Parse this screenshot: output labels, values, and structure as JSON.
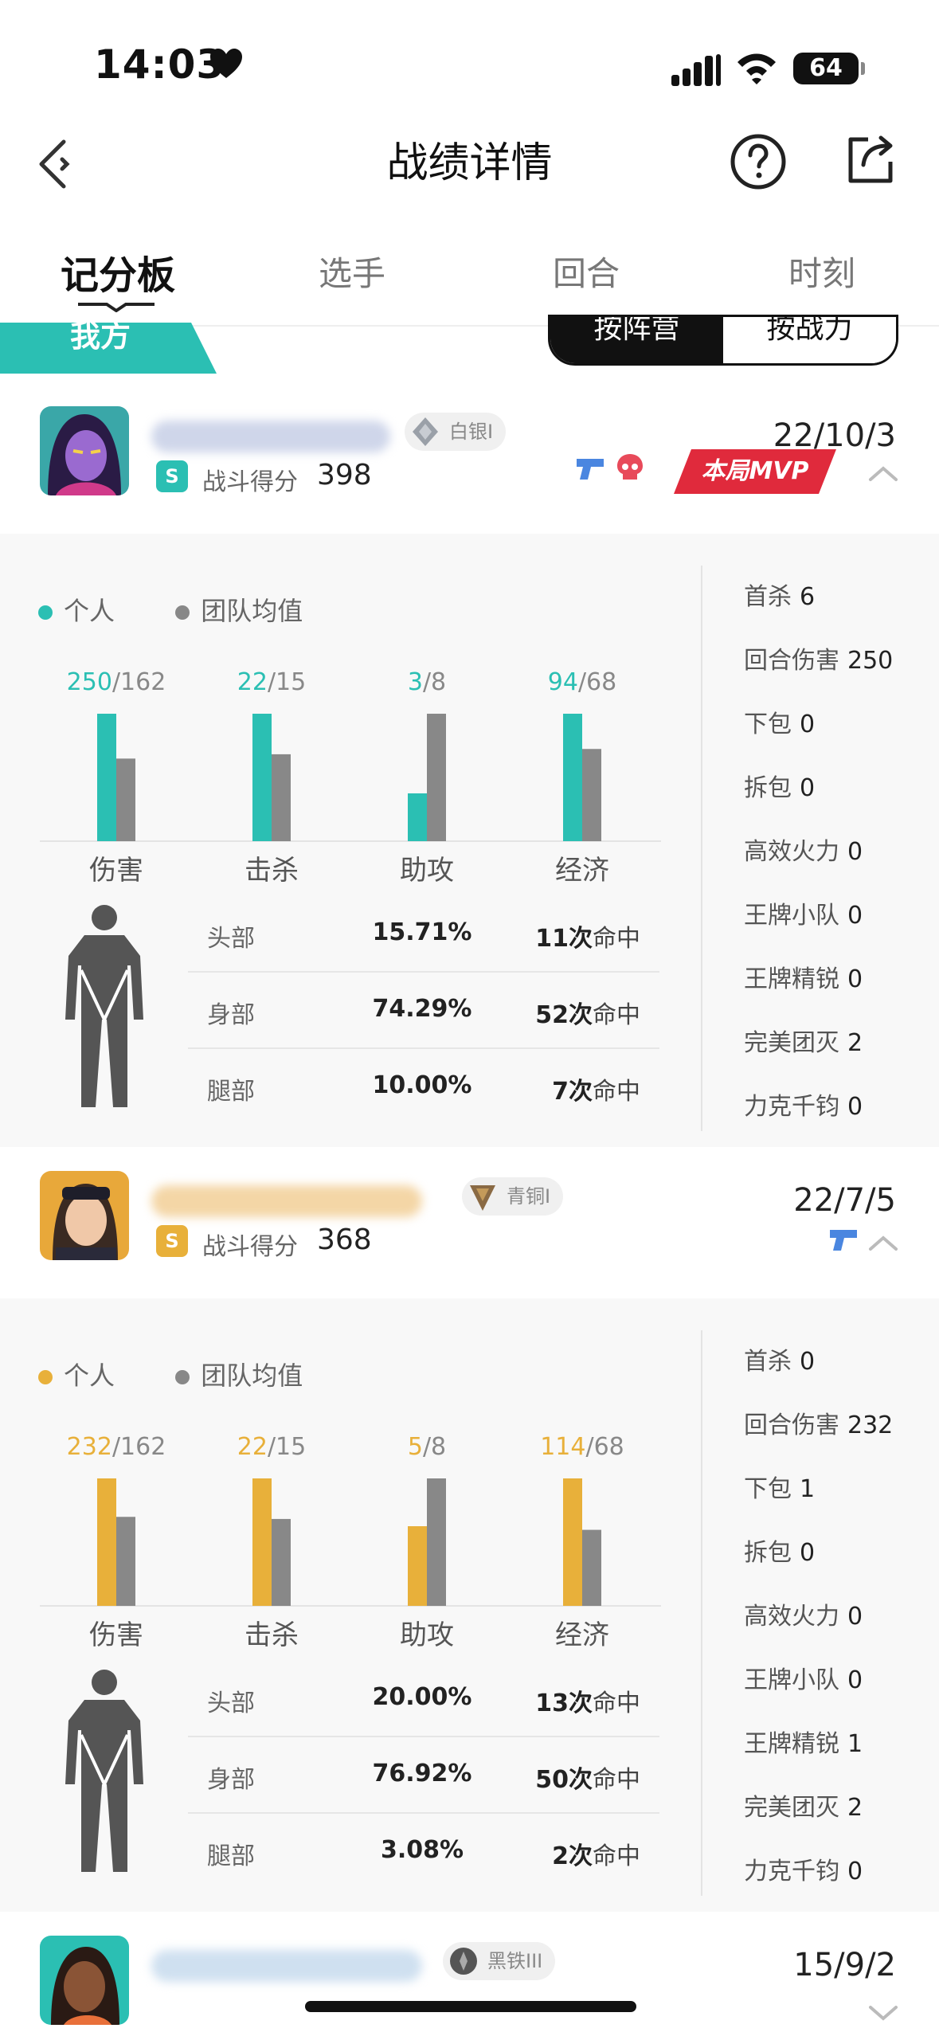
{
  "status_bar": {
    "time": "14:03",
    "battery": "64"
  },
  "header": {
    "title": "战绩详情"
  },
  "tabs": [
    {
      "label": "记分板",
      "active": true
    },
    {
      "label": "选手",
      "active": false
    },
    {
      "label": "回合",
      "active": false
    },
    {
      "label": "时刻",
      "active": false
    }
  ],
  "team_label": "我方",
  "sort_toggle": {
    "option_a": "按阵营",
    "option_b": "按战力",
    "selected": "按阵营"
  },
  "players": [
    {
      "rank": "白银I",
      "score_label": "战斗得分",
      "score": "398",
      "kda": "22/10/3",
      "mvp_badge": "本局MVP",
      "accent": "#2bbfb3",
      "legend_personal": "个人",
      "legend_team": "团队均值",
      "bars": [
        {
          "label": "伤害",
          "personal": 250,
          "team": 162,
          "personal_text": "250",
          "team_text": "/162"
        },
        {
          "label": "击杀",
          "personal": 22,
          "team": 15,
          "personal_text": "22",
          "team_text": "/15"
        },
        {
          "label": "助攻",
          "personal": 3,
          "team": 8,
          "personal_text": "3",
          "team_text": "/8"
        },
        {
          "label": "经济",
          "personal": 94,
          "team": 68,
          "personal_text": "94",
          "team_text": "/68"
        }
      ],
      "hits": [
        {
          "part": "头部",
          "pct": "15.71%",
          "count": "11",
          "count_unit": "次",
          "suffix": "命中"
        },
        {
          "part": "身部",
          "pct": "74.29%",
          "count": "52",
          "count_unit": "次",
          "suffix": "命中"
        },
        {
          "part": "腿部",
          "pct": "10.00%",
          "count": "7",
          "count_unit": "次",
          "suffix": "命中"
        }
      ],
      "stats": [
        {
          "label": "首杀",
          "value": "6"
        },
        {
          "label": "回合伤害",
          "value": "250"
        },
        {
          "label": "下包",
          "value": "0"
        },
        {
          "label": "拆包",
          "value": "0"
        },
        {
          "label": "高效火力",
          "value": "0"
        },
        {
          "label": "王牌小队",
          "value": "0"
        },
        {
          "label": "王牌精锐",
          "value": "0"
        },
        {
          "label": "完美团灭",
          "value": "2"
        },
        {
          "label": "力克千钧",
          "value": "0"
        }
      ]
    },
    {
      "rank": "青铜I",
      "score_label": "战斗得分",
      "score": "368",
      "kda": "22/7/5",
      "accent": "#e8b03a",
      "legend_personal": "个人",
      "legend_team": "团队均值",
      "bars": [
        {
          "label": "伤害",
          "personal": 232,
          "team": 162,
          "personal_text": "232",
          "team_text": "/162"
        },
        {
          "label": "击杀",
          "personal": 22,
          "team": 15,
          "personal_text": "22",
          "team_text": "/15"
        },
        {
          "label": "助攻",
          "personal": 5,
          "team": 8,
          "personal_text": "5",
          "team_text": "/8"
        },
        {
          "label": "经济",
          "personal": 114,
          "team": 68,
          "personal_text": "114",
          "team_text": "/68"
        }
      ],
      "hits": [
        {
          "part": "头部",
          "pct": "20.00%",
          "count": "13",
          "count_unit": "次",
          "suffix": "命中"
        },
        {
          "part": "身部",
          "pct": "76.92%",
          "count": "50",
          "count_unit": "次",
          "suffix": "命中"
        },
        {
          "part": "腿部",
          "pct": "3.08%",
          "count": "2",
          "count_unit": "次",
          "suffix": "命中"
        }
      ],
      "stats": [
        {
          "label": "首杀",
          "value": "0"
        },
        {
          "label": "回合伤害",
          "value": "232"
        },
        {
          "label": "下包",
          "value": "1"
        },
        {
          "label": "拆包",
          "value": "0"
        },
        {
          "label": "高效火力",
          "value": "0"
        },
        {
          "label": "王牌小队",
          "value": "0"
        },
        {
          "label": "王牌精锐",
          "value": "1"
        },
        {
          "label": "完美团灭",
          "value": "2"
        },
        {
          "label": "力克千钧",
          "value": "0"
        }
      ]
    },
    {
      "rank": "黑铁III",
      "kda": "15/9/2"
    }
  ]
}
